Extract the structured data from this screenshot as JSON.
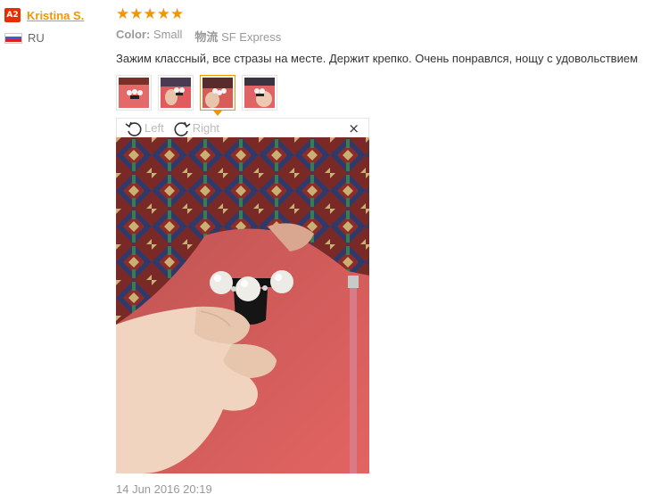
{
  "reviewer": {
    "level_badge": "A2",
    "name": "Kristina S.",
    "country": "RU"
  },
  "review": {
    "rating": 5,
    "stars": [
      "★",
      "★",
      "★",
      "★",
      "★"
    ],
    "color_label": "Color:",
    "color_value": "Small",
    "shipping_label": "物流",
    "shipping_value": "SF Express",
    "text": "Зажим классный, все стразы на месте. Держит крепко. Очень понравлся, нощу с удовольствием",
    "date": "14 Jun 2016 20:19"
  },
  "thumbnails": [
    {
      "name": "thumb-1",
      "active": false
    },
    {
      "name": "thumb-2",
      "active": false
    },
    {
      "name": "thumb-3",
      "active": true
    },
    {
      "name": "thumb-4",
      "active": false
    }
  ],
  "viewer": {
    "rotate_left_label": "Left",
    "rotate_right_label": "Right",
    "close_label": "×"
  },
  "colors": {
    "accent": "#f29500",
    "badge": "#e62e04",
    "muted": "#999999"
  }
}
